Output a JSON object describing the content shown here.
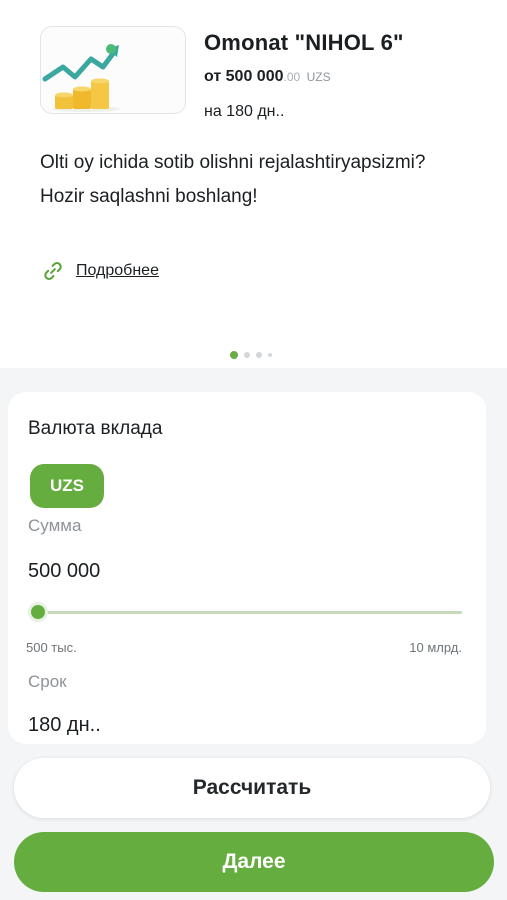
{
  "promo": {
    "title": "Omonat \"NIHOL 6\"",
    "amount_prefix": "от 500 000",
    "amount_decimals": ".00",
    "amount_currency": "UZS",
    "term": "на 180 дн..",
    "description": "Olti oy ichida sotib olishni rejalashtiryapsizmi? Hozir saqlashni boshlang!",
    "link_label": "Подробнее",
    "link_icon": "link-icon",
    "carousel_page": 1,
    "carousel_total": 4
  },
  "deposit": {
    "currency_label": "Валюта вклада",
    "currency_selected": "UZS",
    "sum_label": "Сумма",
    "sum_value": "500 000",
    "slider_fraction": 0.0,
    "range_min": "500 тыс.",
    "range_max": "10 млрд.",
    "term_label": "Срок",
    "term_value": "180 дн.."
  },
  "actions": {
    "calculate_label": "Рассчитать",
    "next_label": "Далее"
  },
  "colors": {
    "accent": "#65ad3f",
    "background": "#f3f5f6"
  }
}
